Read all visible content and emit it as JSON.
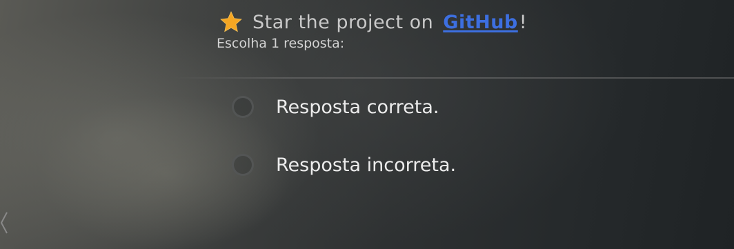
{
  "banner": {
    "icon": "star-icon",
    "icon_color": "#f5a623",
    "text": "Star the project on",
    "link_text": "GitHub",
    "link_color": "#3d6fe0",
    "suffix": "!"
  },
  "question": {
    "instruction": "Escolha 1 resposta:"
  },
  "answers": [
    {
      "label": "Resposta correta.",
      "selected": false
    },
    {
      "label": "Resposta incorreta.",
      "selected": false
    }
  ]
}
